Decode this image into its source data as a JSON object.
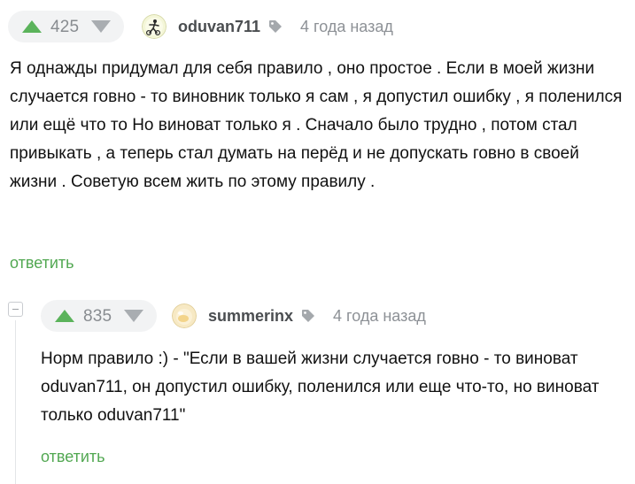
{
  "comments": [
    {
      "score": "425",
      "username": "oduvan711",
      "time": "4 года назад",
      "text": "Я однажды придумал для себя правило , оно простое . Если в моей жизни случается говно - то виновник только я сам , я допустил ошибку , я поленился или ещё что то Но виноват только я . Сначало было трудно , потом стал привыкать , а теперь стал думать на перёд и не допускать говно в своей жизни . Советую всем жить по этому правилу .",
      "reply_label": "ответить"
    },
    {
      "score": "835",
      "username": "summerinx",
      "time": "4 года назад",
      "text": "Норм правило :)  - \"Если в вашей жизни случается говно - то виноват oduvan711, он допустил ошибку, поленился или еще что-то, но виноват только oduvan711\"",
      "reply_label": "ответить"
    }
  ],
  "icons": {
    "upvote": "triangle-up-icon",
    "downvote": "triangle-down-icon",
    "tag": "tag-icon"
  },
  "colors": {
    "upvote": "#5bb35b",
    "downvote": "#a9adb1",
    "reply": "#52a852",
    "username": "#4a4d50",
    "muted": "#8d9196",
    "pill": "#f2f3f4"
  }
}
